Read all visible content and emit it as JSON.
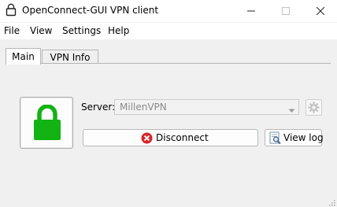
{
  "window": {
    "title": "OpenConnect-GUI VPN client",
    "app_icon": "padlock-outline-icon",
    "controls": [
      "minimize-icon",
      "maximize-icon",
      "close-icon"
    ]
  },
  "menu": {
    "items": [
      "File",
      "View",
      "Settings",
      "Help"
    ]
  },
  "tabs": [
    {
      "label": "Main",
      "active": true
    },
    {
      "label": "VPN Info",
      "active": false
    }
  ],
  "status": {
    "icon": "padlock-locked-icon",
    "color": "#12b312"
  },
  "server": {
    "label": "Server:",
    "selected": "MillenVPN",
    "enabled": false,
    "settings_icon": "gear-icon"
  },
  "actions": {
    "disconnect_label": "Disconnect",
    "disconnect_icon": "red-x-circle-icon",
    "viewlog_label": "View log",
    "viewlog_icon": "log-search-icon"
  }
}
